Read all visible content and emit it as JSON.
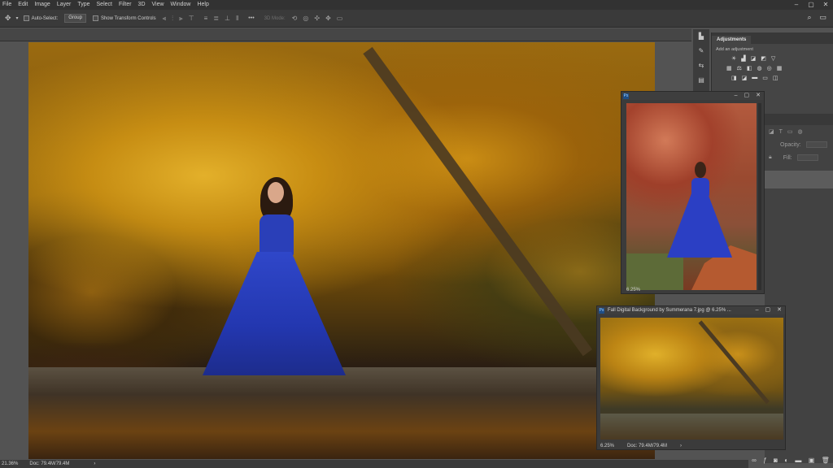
{
  "menu": [
    "File",
    "Edit",
    "Image",
    "Layer",
    "Type",
    "Select",
    "Filter",
    "3D",
    "View",
    "Window",
    "Help"
  ],
  "window_controls": [
    "–",
    "▢",
    "✕"
  ],
  "options": {
    "auto_select_label": "Auto-Select:",
    "auto_select_value": "Group",
    "transform_label": "Show Transform Controls",
    "mode_3d_label": "3D Mode:",
    "more": "•••"
  },
  "adjustments": {
    "tab": "Adjustments",
    "hint": "Add an adjustment"
  },
  "layers": {
    "opacity_label": "Opacity:",
    "fill_label": "Fill:"
  },
  "doc_window_1": {
    "zoom": "6.25%"
  },
  "doc_window_2": {
    "title": "Fall Digital Background by Summerana 7.jpg @ 6.25% ...",
    "zoom": "6.25%",
    "doc": "Doc: 79.4M/79.4M"
  },
  "status_bar": {
    "zoom": "21.36%",
    "doc": "Doc: 79.4M/79.4M",
    "arrow": "›"
  },
  "icons": [
    "move-tool-icon",
    "search-icon",
    "workspace-icon"
  ]
}
